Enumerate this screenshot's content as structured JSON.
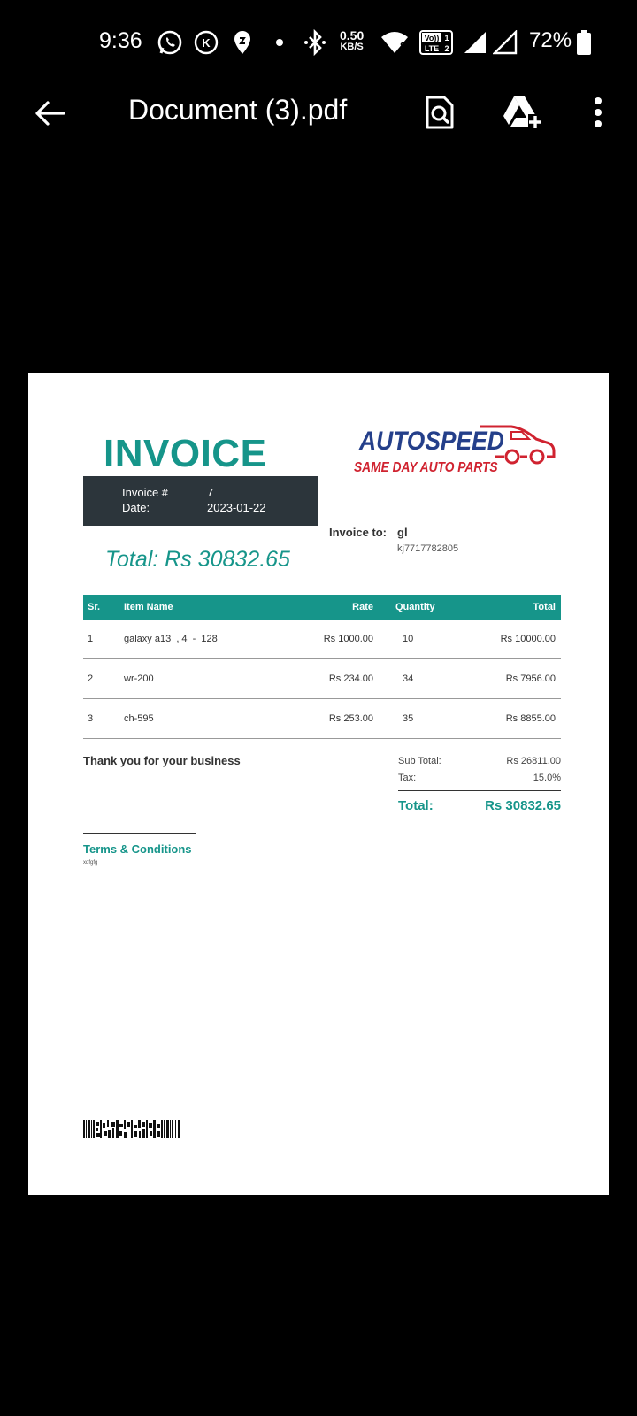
{
  "status_bar": {
    "time": "9:36",
    "net_speed_value": "0.50",
    "net_speed_unit": "KB/S",
    "lte_top": "Vo))",
    "lte_sub": "LTE",
    "sim1": "1",
    "sim2": "2",
    "battery_percent": "72%",
    "icons": [
      "whatsapp-icon",
      "k-app-icon",
      "location-pin-icon",
      "dot-icon",
      "bluetooth-icon",
      "wifi-icon",
      "volte-icon",
      "signal-icon",
      "signal-icon",
      "battery-icon"
    ]
  },
  "app_bar": {
    "title": "Document (3).pdf",
    "actions": [
      "back-arrow-icon",
      "document-search-icon",
      "drive-add-icon",
      "more-vert-icon"
    ]
  },
  "invoice": {
    "heading": "INVOICE",
    "meta": {
      "number_label": "Invoice #",
      "number_value": "7",
      "date_label": "Date:",
      "date_value": "2023-01-22"
    },
    "total_banner": "Total: Rs 30832.65",
    "logo": {
      "line1": "AUTOSPEED",
      "line2": "SAME DAY AUTO PARTS",
      "brand_blue": "#243f8a",
      "brand_red": "#d02330"
    },
    "bill_to": {
      "label": "Invoice to:",
      "name": "gl",
      "phone": "kj7717782805"
    },
    "table": {
      "headers": {
        "sr": "Sr.",
        "item": "Item Name",
        "rate": "Rate",
        "qty": "Quantity",
        "total": "Total"
      },
      "rows": [
        {
          "sr": "1",
          "item": "galaxy a13  , 4  -  128",
          "rate": "Rs 1000.00",
          "qty": "10",
          "total": "Rs 10000.00"
        },
        {
          "sr": "2",
          "item": "wr-200",
          "rate": "Rs 234.00",
          "qty": "34",
          "total": "Rs 7956.00"
        },
        {
          "sr": "3",
          "item": "ch-595",
          "rate": "Rs 253.00",
          "qty": "35",
          "total": "Rs 8855.00"
        }
      ]
    },
    "thanks": "Thank you for your business",
    "summary": {
      "subtotal_label": "Sub Total:",
      "subtotal_value": "Rs 26811.00",
      "tax_label": "Tax:",
      "tax_value": "15.0%",
      "total_label": "Total:",
      "total_value": "Rs 30832.65"
    },
    "terms": {
      "title": "Terms & Conditions",
      "body": "xdfgfg"
    },
    "accent_color": "#16958a"
  }
}
